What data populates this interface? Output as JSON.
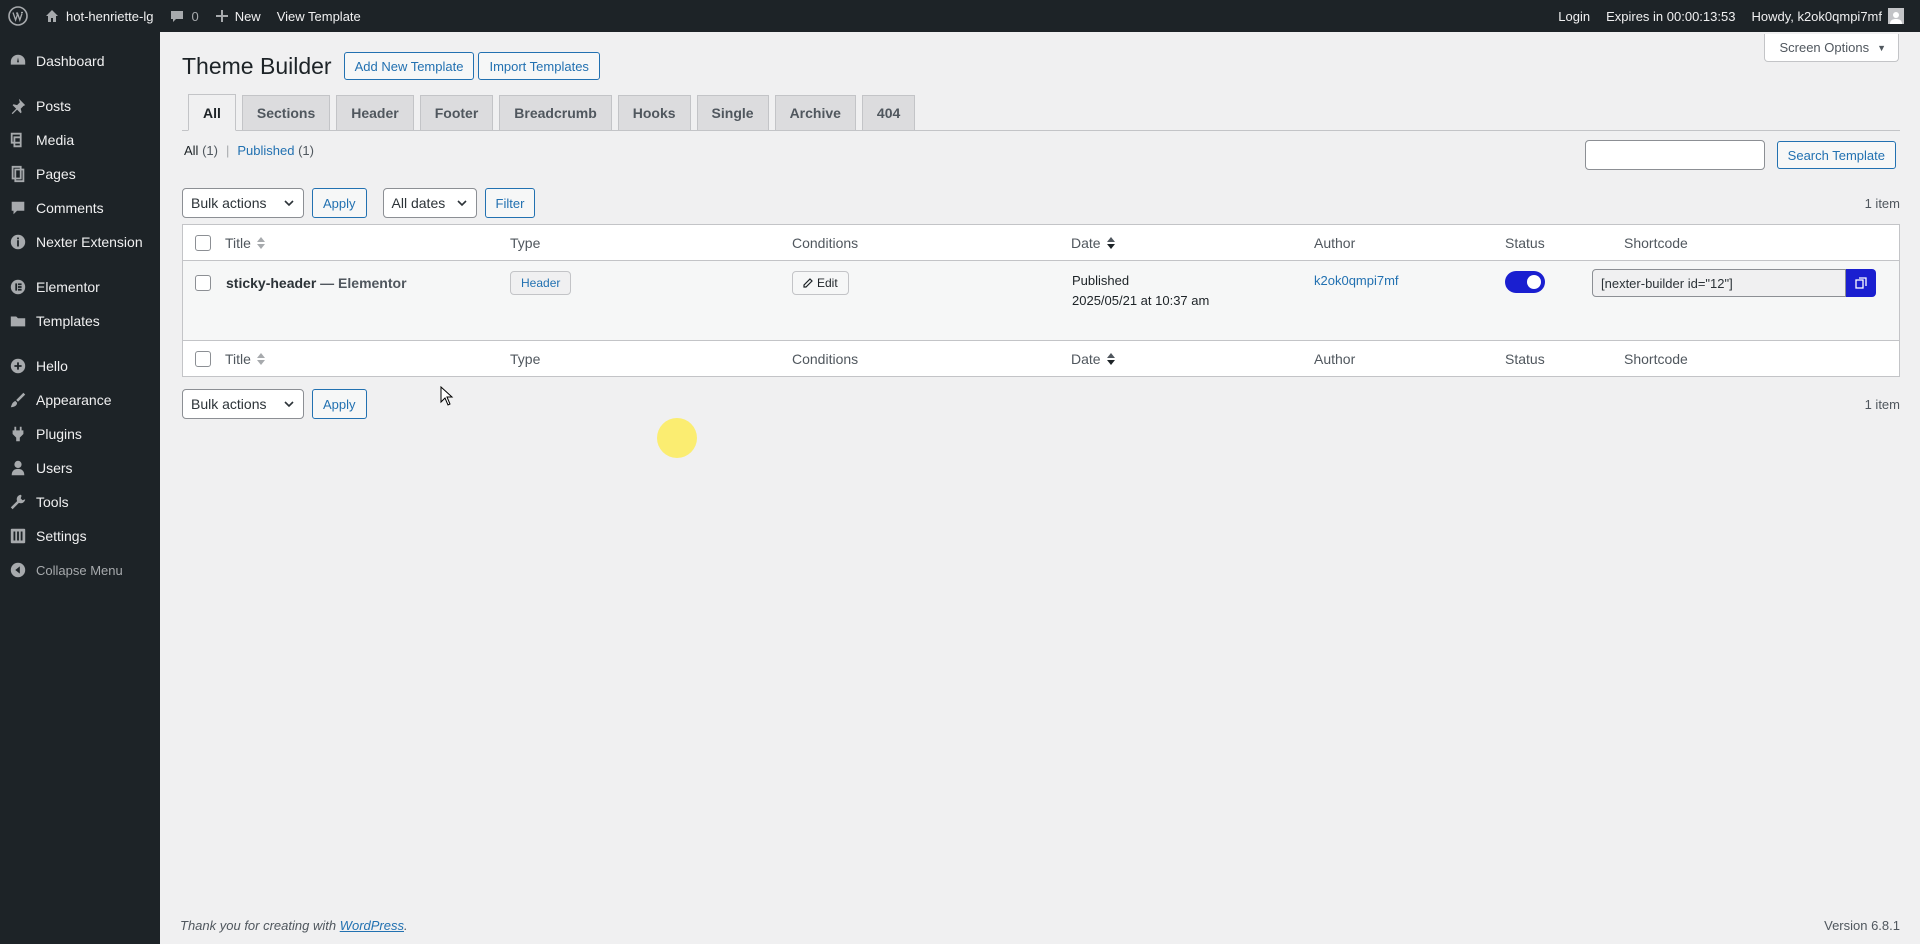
{
  "adminbar": {
    "site_name": "hot-henriette-lg",
    "comments_count": "0",
    "new_label": "New",
    "view_template": "View Template",
    "login": "Login",
    "expires": "Expires in 00:00:13:53",
    "howdy": "Howdy, k2ok0qmpi7mf"
  },
  "sidebar": {
    "items": [
      {
        "label": "Dashboard",
        "icon": "dashboard-icon"
      },
      {
        "label": "Posts",
        "icon": "pin-icon"
      },
      {
        "label": "Media",
        "icon": "media-icon"
      },
      {
        "label": "Pages",
        "icon": "pages-icon"
      },
      {
        "label": "Comments",
        "icon": "comments-icon"
      },
      {
        "label": "Nexter Extension",
        "icon": "info-icon"
      },
      {
        "label": "Elementor",
        "icon": "elementor-icon"
      },
      {
        "label": "Templates",
        "icon": "folder-icon"
      },
      {
        "label": "Hello",
        "icon": "plus-circle-icon"
      },
      {
        "label": "Appearance",
        "icon": "brush-icon"
      },
      {
        "label": "Plugins",
        "icon": "plugin-icon"
      },
      {
        "label": "Users",
        "icon": "user-icon"
      },
      {
        "label": "Tools",
        "icon": "wrench-icon"
      },
      {
        "label": "Settings",
        "icon": "settings-icon"
      }
    ],
    "collapse": "Collapse Menu"
  },
  "screen_options": "Screen Options",
  "page": {
    "title": "Theme Builder",
    "add_new": "Add New Template",
    "import": "Import Templates"
  },
  "tabs": [
    "All",
    "Sections",
    "Header",
    "Footer",
    "Breadcrumb",
    "Hooks",
    "Single",
    "Archive",
    "404"
  ],
  "views": {
    "all_label": "All",
    "all_count": "(1)",
    "sep": "|",
    "published_label": "Published",
    "published_count": "(1)"
  },
  "search": {
    "button": "Search Template",
    "value": ""
  },
  "tablenav_top": {
    "bulk": "Bulk actions",
    "apply": "Apply",
    "dates": "All dates",
    "filter": "Filter",
    "count": "1 item"
  },
  "tablenav_bottom": {
    "bulk": "Bulk actions",
    "apply": "Apply",
    "count": "1 item"
  },
  "table": {
    "columns": {
      "title": "Title",
      "type": "Type",
      "conditions": "Conditions",
      "date": "Date",
      "author": "Author",
      "status": "Status",
      "shortcode": "Shortcode"
    },
    "rows": [
      {
        "title": "sticky-header",
        "suffix": "— Elementor",
        "type": "Header",
        "conditions": "Edit",
        "date_status": "Published",
        "date": "2025/05/21 at 10:37 am",
        "author": "k2ok0qmpi7mf",
        "status_on": true,
        "shortcode": "[nexter-builder id=\"12\"]"
      }
    ]
  },
  "footer": {
    "thanks_pre": "Thank you for creating with",
    "wp_link": "WordPress",
    "thanks_post": ".",
    "version": "Version 6.8.1"
  },
  "colors": {
    "accent": "#2271b1",
    "toggle": "#1a1fd0",
    "adminbar": "#1d2327"
  }
}
